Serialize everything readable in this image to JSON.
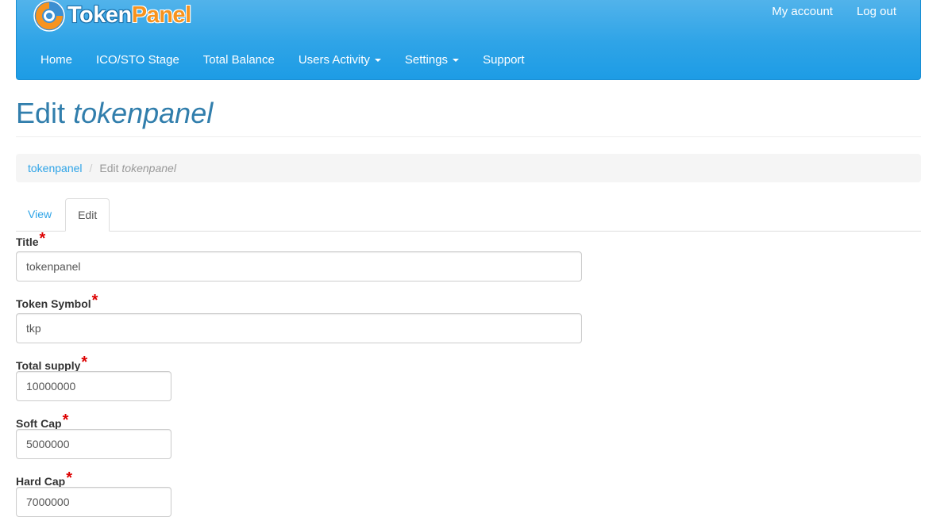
{
  "brand": {
    "logo_part1": "Token",
    "logo_part2": "Panel"
  },
  "header_links": {
    "my_account": "My account",
    "log_out": "Log out"
  },
  "nav": {
    "home": "Home",
    "ico_sto_stage": "ICO/STO Stage",
    "total_balance": "Total Balance",
    "users_activity": "Users Activity",
    "settings": "Settings",
    "support": "Support"
  },
  "page": {
    "title_prefix": "Edit",
    "title_name": "tokenpanel"
  },
  "breadcrumb": {
    "parent": "tokenpanel",
    "current_prefix": "Edit",
    "current_name": "tokenpanel"
  },
  "tabs": {
    "view": "View",
    "edit": "Edit"
  },
  "form": {
    "required_mark": "*",
    "title": {
      "label": "Title",
      "value": "tokenpanel"
    },
    "token_symbol": {
      "label": "Token Symbol",
      "value": "tkp"
    },
    "total_supply": {
      "label": "Total supply",
      "value": "10000000"
    },
    "soft_cap": {
      "label": "Soft Cap",
      "value": "5000000"
    },
    "hard_cap": {
      "label": "Hard Cap",
      "value": "7000000"
    }
  },
  "colors": {
    "navbar": "#2fa4e7",
    "page_title": "#317eac",
    "link": "#2fa4e7",
    "required": "#dd0000",
    "logo_accent": "#f7931e"
  }
}
